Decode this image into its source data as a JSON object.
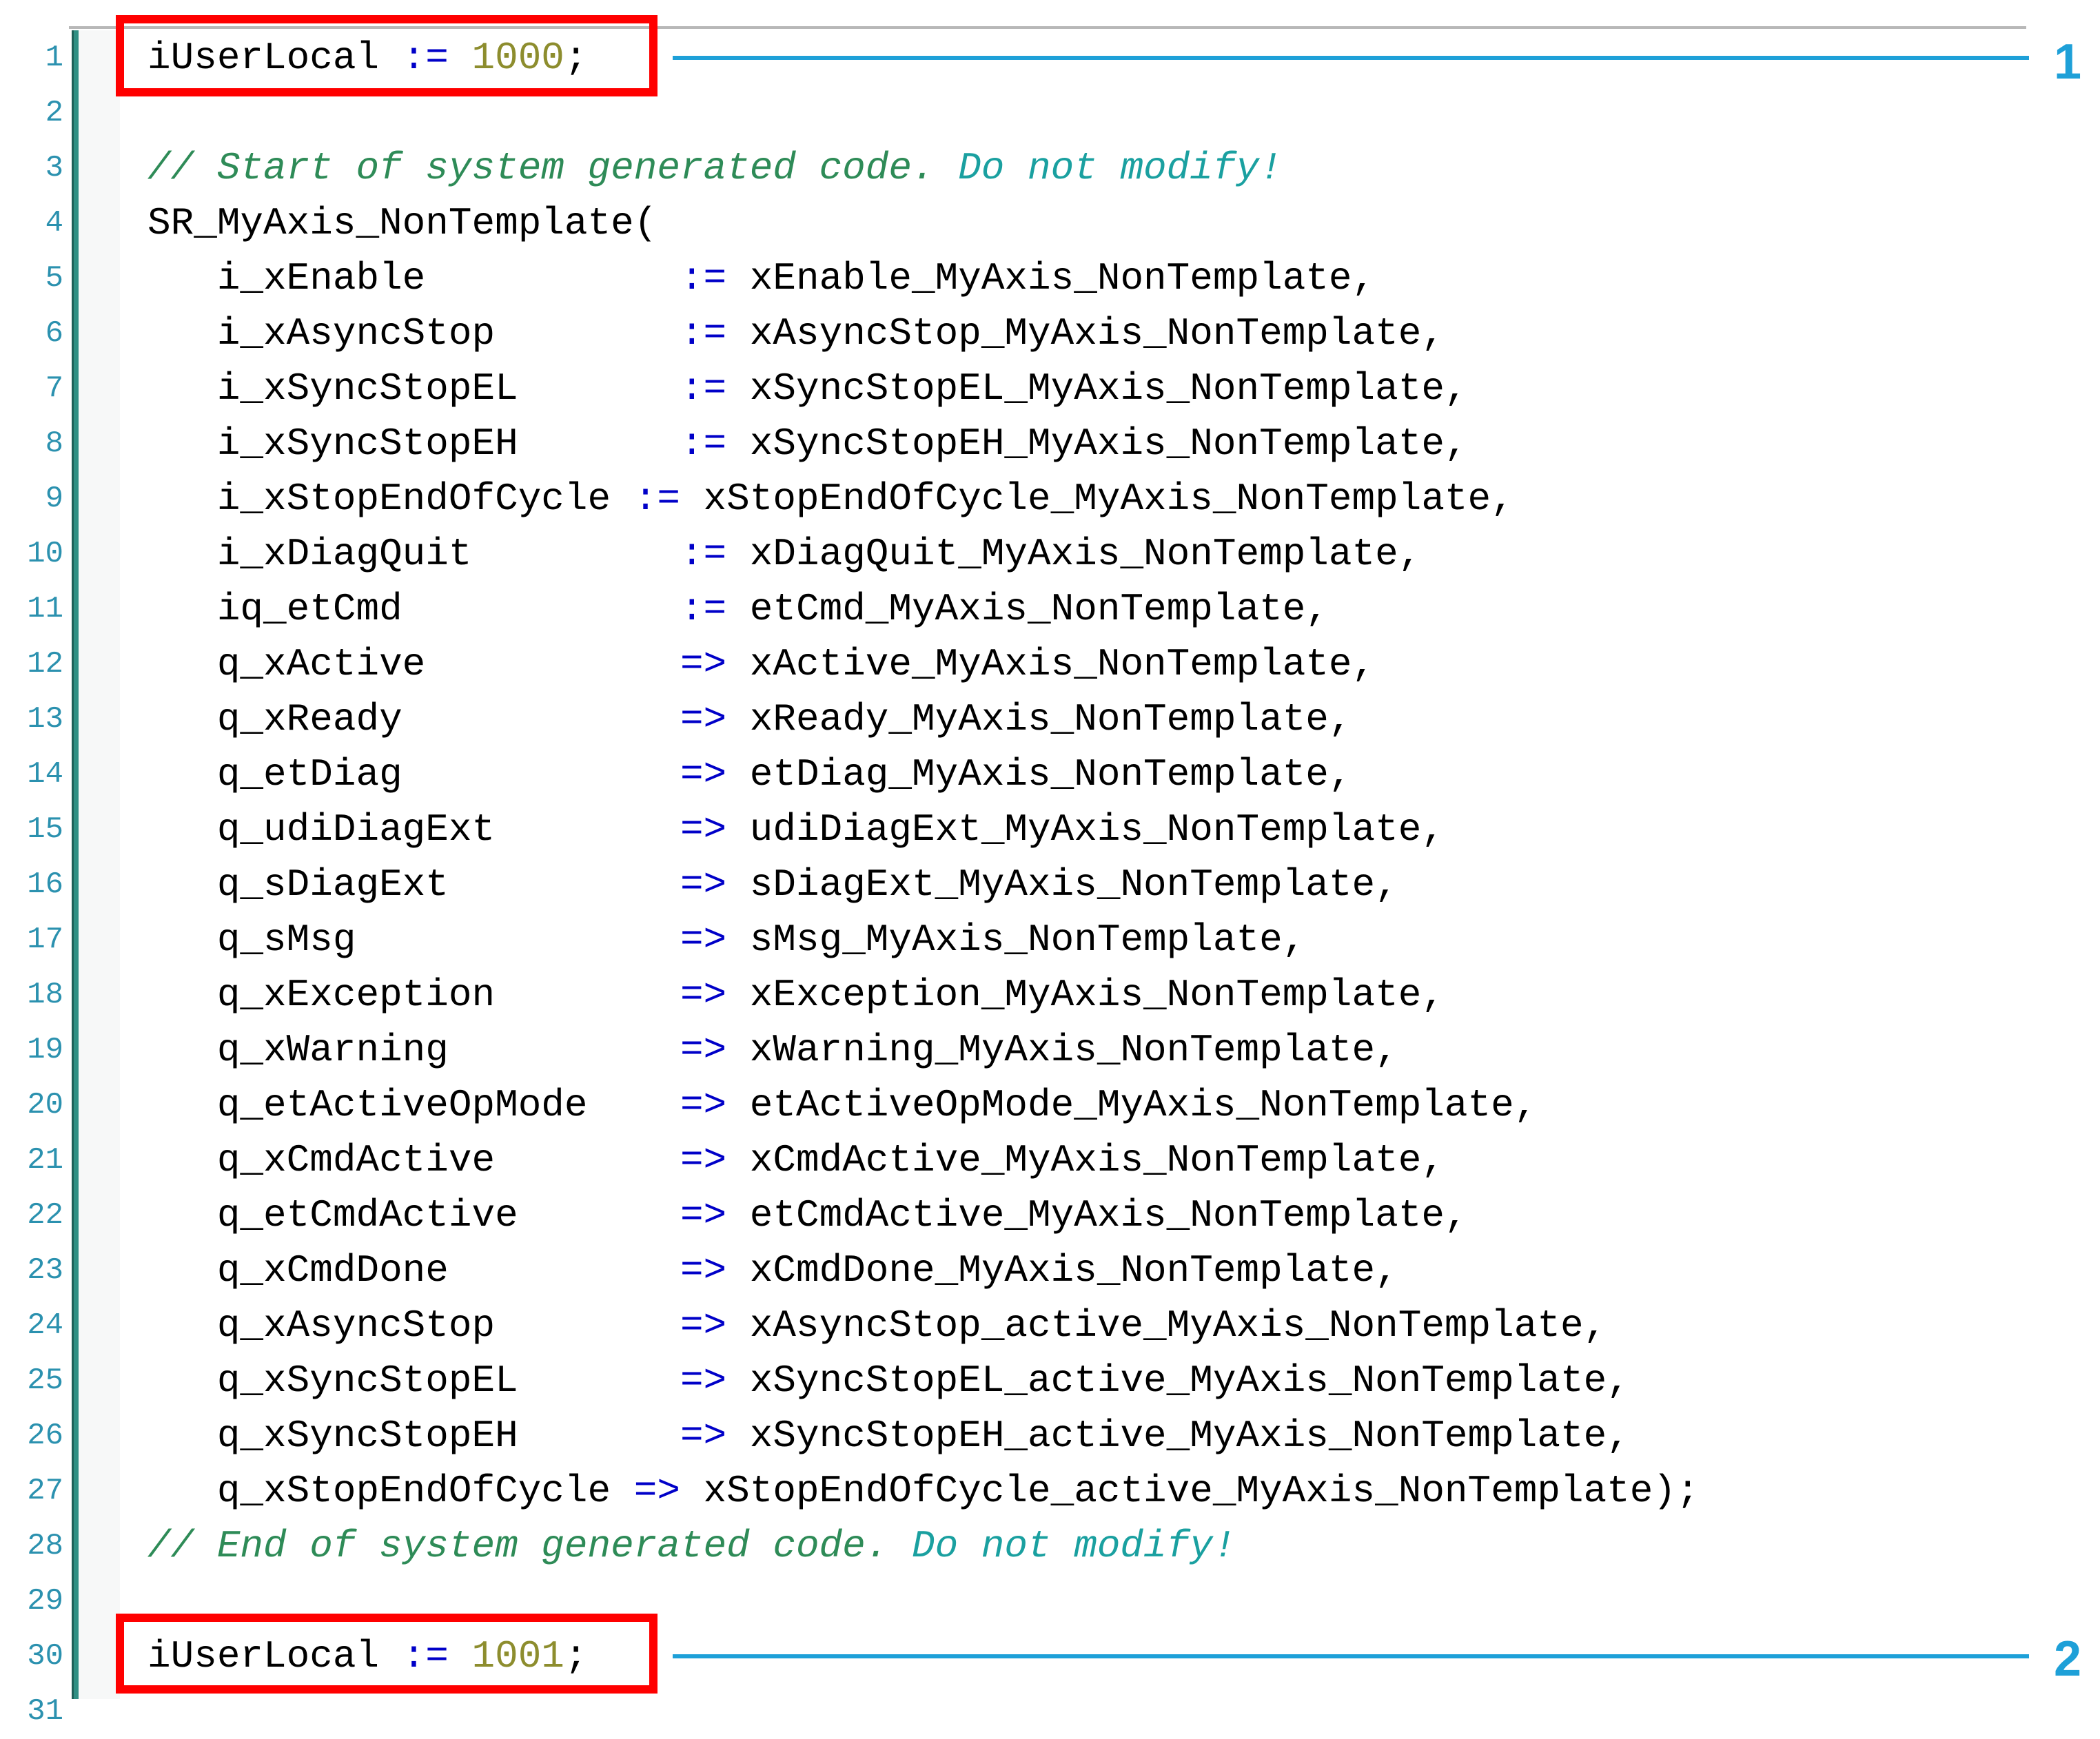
{
  "editor": {
    "line_numbers": [
      "1",
      "2",
      "3",
      "4",
      "5",
      "6",
      "7",
      "8",
      "9",
      "10",
      "11",
      "12",
      "13",
      "14",
      "15",
      "16",
      "17",
      "18",
      "19",
      "20",
      "21",
      "22",
      "23",
      "24",
      "25",
      "26",
      "27",
      "28",
      "29",
      "30",
      "31"
    ],
    "lines": [
      {
        "indent": "",
        "parts": [
          {
            "t": "iUserLocal",
            "c": "ident"
          },
          {
            "t": " := ",
            "c": "op"
          },
          {
            "t": "1000",
            "c": "num"
          },
          {
            "t": ";",
            "c": "ident"
          }
        ]
      },
      {
        "indent": "",
        "parts": []
      },
      {
        "indent": "",
        "parts": [
          {
            "t": "// Start of system generated code. ",
            "c": "comment"
          },
          {
            "t": "Do not modify!",
            "c": "comment-cyan"
          }
        ]
      },
      {
        "indent": "",
        "parts": [
          {
            "t": "SR_MyAxis_NonTemplate(",
            "c": "ident"
          }
        ]
      },
      {
        "indent": "   ",
        "parts": [
          {
            "t": "i_xEnable         ",
            "c": "ident"
          },
          {
            "t": "  := ",
            "c": "op"
          },
          {
            "t": "xEnable_MyAxis_NonTemplate,",
            "c": "ident"
          }
        ]
      },
      {
        "indent": "   ",
        "parts": [
          {
            "t": "i_xAsyncStop      ",
            "c": "ident"
          },
          {
            "t": "  := ",
            "c": "op"
          },
          {
            "t": "xAsyncStop_MyAxis_NonTemplate,",
            "c": "ident"
          }
        ]
      },
      {
        "indent": "   ",
        "parts": [
          {
            "t": "i_xSyncStopEL     ",
            "c": "ident"
          },
          {
            "t": "  := ",
            "c": "op"
          },
          {
            "t": "xSyncStopEL_MyAxis_NonTemplate,",
            "c": "ident"
          }
        ]
      },
      {
        "indent": "   ",
        "parts": [
          {
            "t": "i_xSyncStopEH     ",
            "c": "ident"
          },
          {
            "t": "  := ",
            "c": "op"
          },
          {
            "t": "xSyncStopEH_MyAxis_NonTemplate,",
            "c": "ident"
          }
        ]
      },
      {
        "indent": "   ",
        "parts": [
          {
            "t": "i_xStopEndOfCycle",
            "c": "ident"
          },
          {
            "t": " := ",
            "c": "op"
          },
          {
            "t": "xStopEndOfCycle_MyAxis_NonTemplate,",
            "c": "ident"
          }
        ]
      },
      {
        "indent": "   ",
        "parts": [
          {
            "t": "i_xDiagQuit       ",
            "c": "ident"
          },
          {
            "t": "  := ",
            "c": "op"
          },
          {
            "t": "xDiagQuit_MyAxis_NonTemplate,",
            "c": "ident"
          }
        ]
      },
      {
        "indent": "   ",
        "parts": [
          {
            "t": "iq_etCmd          ",
            "c": "ident"
          },
          {
            "t": "  := ",
            "c": "op"
          },
          {
            "t": "etCmd_MyAxis_NonTemplate,",
            "c": "ident"
          }
        ]
      },
      {
        "indent": "   ",
        "parts": [
          {
            "t": "q_xActive         ",
            "c": "ident"
          },
          {
            "t": "  => ",
            "c": "op"
          },
          {
            "t": "xActive_MyAxis_NonTemplate,",
            "c": "ident"
          }
        ]
      },
      {
        "indent": "   ",
        "parts": [
          {
            "t": "q_xReady          ",
            "c": "ident"
          },
          {
            "t": "  => ",
            "c": "op"
          },
          {
            "t": "xReady_MyAxis_NonTemplate,",
            "c": "ident"
          }
        ]
      },
      {
        "indent": "   ",
        "parts": [
          {
            "t": "q_etDiag          ",
            "c": "ident"
          },
          {
            "t": "  => ",
            "c": "op"
          },
          {
            "t": "etDiag_MyAxis_NonTemplate,",
            "c": "ident"
          }
        ]
      },
      {
        "indent": "   ",
        "parts": [
          {
            "t": "q_udiDiagExt      ",
            "c": "ident"
          },
          {
            "t": "  => ",
            "c": "op"
          },
          {
            "t": "udiDiagExt_MyAxis_NonTemplate,",
            "c": "ident"
          }
        ]
      },
      {
        "indent": "   ",
        "parts": [
          {
            "t": "q_sDiagExt        ",
            "c": "ident"
          },
          {
            "t": "  => ",
            "c": "op"
          },
          {
            "t": "sDiagExt_MyAxis_NonTemplate,",
            "c": "ident"
          }
        ]
      },
      {
        "indent": "   ",
        "parts": [
          {
            "t": "q_sMsg            ",
            "c": "ident"
          },
          {
            "t": "  => ",
            "c": "op"
          },
          {
            "t": "sMsg_MyAxis_NonTemplate,",
            "c": "ident"
          }
        ]
      },
      {
        "indent": "   ",
        "parts": [
          {
            "t": "q_xException      ",
            "c": "ident"
          },
          {
            "t": "  => ",
            "c": "op"
          },
          {
            "t": "xException_MyAxis_NonTemplate,",
            "c": "ident"
          }
        ]
      },
      {
        "indent": "   ",
        "parts": [
          {
            "t": "q_xWarning        ",
            "c": "ident"
          },
          {
            "t": "  => ",
            "c": "op"
          },
          {
            "t": "xWarning_MyAxis_NonTemplate,",
            "c": "ident"
          }
        ]
      },
      {
        "indent": "   ",
        "parts": [
          {
            "t": "q_etActiveOpMode  ",
            "c": "ident"
          },
          {
            "t": "  => ",
            "c": "op"
          },
          {
            "t": "etActiveOpMode_MyAxis_NonTemplate,",
            "c": "ident"
          }
        ]
      },
      {
        "indent": "   ",
        "parts": [
          {
            "t": "q_xCmdActive      ",
            "c": "ident"
          },
          {
            "t": "  => ",
            "c": "op"
          },
          {
            "t": "xCmdActive_MyAxis_NonTemplate,",
            "c": "ident"
          }
        ]
      },
      {
        "indent": "   ",
        "parts": [
          {
            "t": "q_etCmdActive     ",
            "c": "ident"
          },
          {
            "t": "  => ",
            "c": "op"
          },
          {
            "t": "etCmdActive_MyAxis_NonTemplate,",
            "c": "ident"
          }
        ]
      },
      {
        "indent": "   ",
        "parts": [
          {
            "t": "q_xCmdDone        ",
            "c": "ident"
          },
          {
            "t": "  => ",
            "c": "op"
          },
          {
            "t": "xCmdDone_MyAxis_NonTemplate,",
            "c": "ident"
          }
        ]
      },
      {
        "indent": "   ",
        "parts": [
          {
            "t": "q_xAsyncStop      ",
            "c": "ident"
          },
          {
            "t": "  => ",
            "c": "op"
          },
          {
            "t": "xAsyncStop_active_MyAxis_NonTemplate,",
            "c": "ident"
          }
        ]
      },
      {
        "indent": "   ",
        "parts": [
          {
            "t": "q_xSyncStopEL     ",
            "c": "ident"
          },
          {
            "t": "  => ",
            "c": "op"
          },
          {
            "t": "xSyncStopEL_active_MyAxis_NonTemplate,",
            "c": "ident"
          }
        ]
      },
      {
        "indent": "   ",
        "parts": [
          {
            "t": "q_xSyncStopEH     ",
            "c": "ident"
          },
          {
            "t": "  => ",
            "c": "op"
          },
          {
            "t": "xSyncStopEH_active_MyAxis_NonTemplate,",
            "c": "ident"
          }
        ]
      },
      {
        "indent": "   ",
        "parts": [
          {
            "t": "q_xStopEndOfCycle",
            "c": "ident"
          },
          {
            "t": " => ",
            "c": "op"
          },
          {
            "t": "xStopEndOfCycle_active_MyAxis_NonTemplate);",
            "c": "ident"
          }
        ]
      },
      {
        "indent": "",
        "parts": [
          {
            "t": "// End of system generated code. ",
            "c": "comment"
          },
          {
            "t": "Do not modify!",
            "c": "comment-cyan"
          }
        ]
      },
      {
        "indent": "",
        "parts": []
      },
      {
        "indent": "",
        "parts": [
          {
            "t": "iUserLocal",
            "c": "ident"
          },
          {
            "t": " := ",
            "c": "op"
          },
          {
            "t": "1001",
            "c": "num"
          },
          {
            "t": ";",
            "c": "ident"
          }
        ]
      },
      {
        "indent": "",
        "parts": []
      }
    ]
  },
  "callouts": [
    {
      "label": "1",
      "color": "#1ea0d8"
    },
    {
      "label": "2",
      "color": "#1ea0d8"
    }
  ],
  "colors": {
    "highlight_box": "#ff0000",
    "line_number": "#2b91af",
    "comment": "#2e8b57",
    "comment_cyan": "#1aa0a0",
    "number": "#8d8d2e",
    "operator": "#0000c8",
    "gutter_bar": "#2f8f83"
  }
}
